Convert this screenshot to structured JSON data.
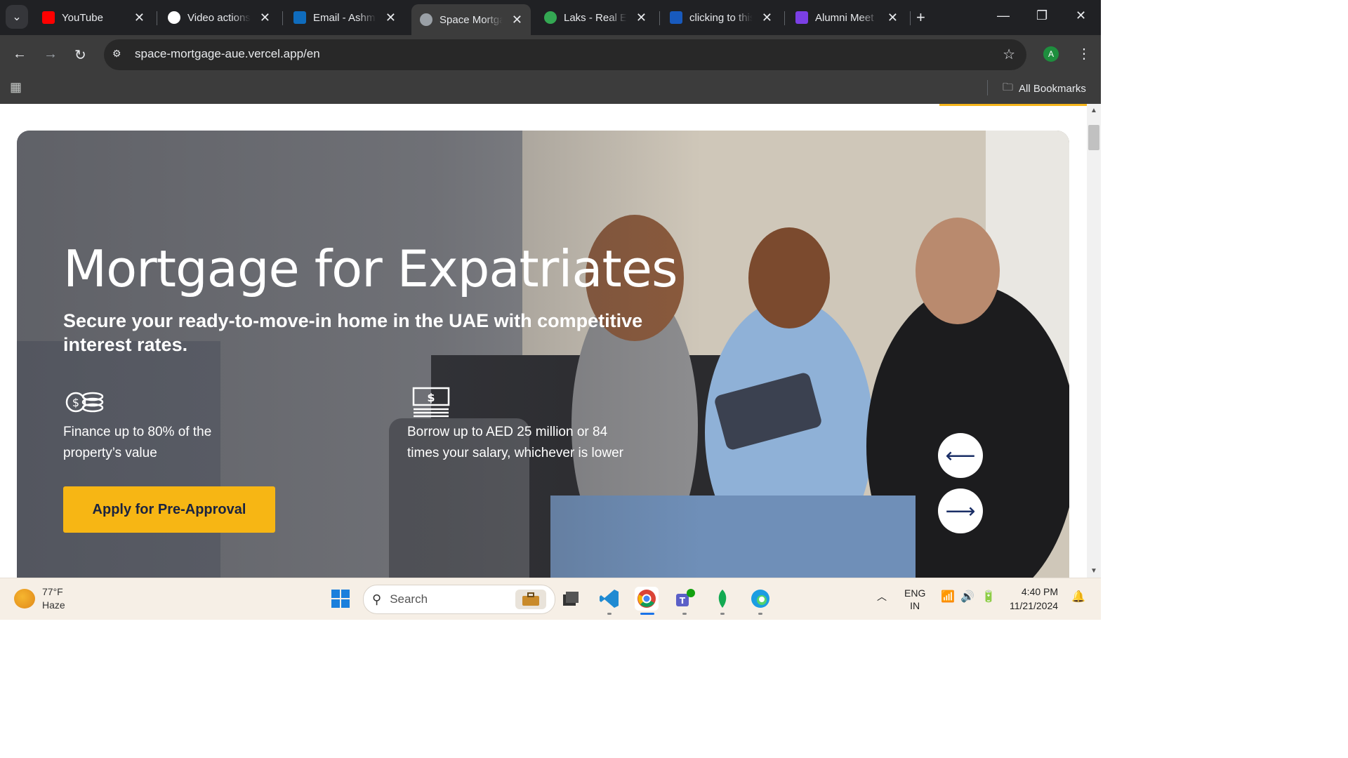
{
  "browser": {
    "tabs": [
      {
        "title": "YouTube",
        "favicon_color": "#ff0000",
        "active": false
      },
      {
        "title": "Video actions",
        "favicon_color": "#ffffff",
        "active": false
      },
      {
        "title": "Email - Ashmit",
        "favicon_color": "#0f6cbd",
        "active": false
      },
      {
        "title": "Space Mortgage",
        "favicon_color": "#9aa0a6",
        "active": true
      },
      {
        "title": "Laks - Real Est",
        "favicon_color": "#34a853",
        "active": false
      },
      {
        "title": "clicking to this",
        "favicon_color": "#185abd",
        "active": false
      },
      {
        "title": "Alumni Meet",
        "favicon_color": "#7b3fe4",
        "active": false
      }
    ],
    "url": "space-mortgage-aue.vercel.app/en",
    "profile_initial": "A",
    "bookmarks_label": "All Bookmarks"
  },
  "hero": {
    "title": "Mortgage for Expatriates",
    "subtitle": "Secure your ready-to-move-in home in the UAE with competitive interest rates.",
    "features": [
      {
        "icon": "coins-icon",
        "text": "Finance up to 80% of the property’s value"
      },
      {
        "icon": "cash-icon",
        "text": "Borrow up to AED 25 million or 84 times your salary, whichever is lower"
      }
    ],
    "cta_label": "Apply for Pre-Approval",
    "accent_color": "#f7b614"
  },
  "taskbar": {
    "weather_temp": "77°F",
    "weather_desc": "Haze",
    "search_placeholder": "Search",
    "lang_line1": "ENG",
    "lang_line2": "IN",
    "time": "4:40 PM",
    "date": "11/21/2024"
  }
}
